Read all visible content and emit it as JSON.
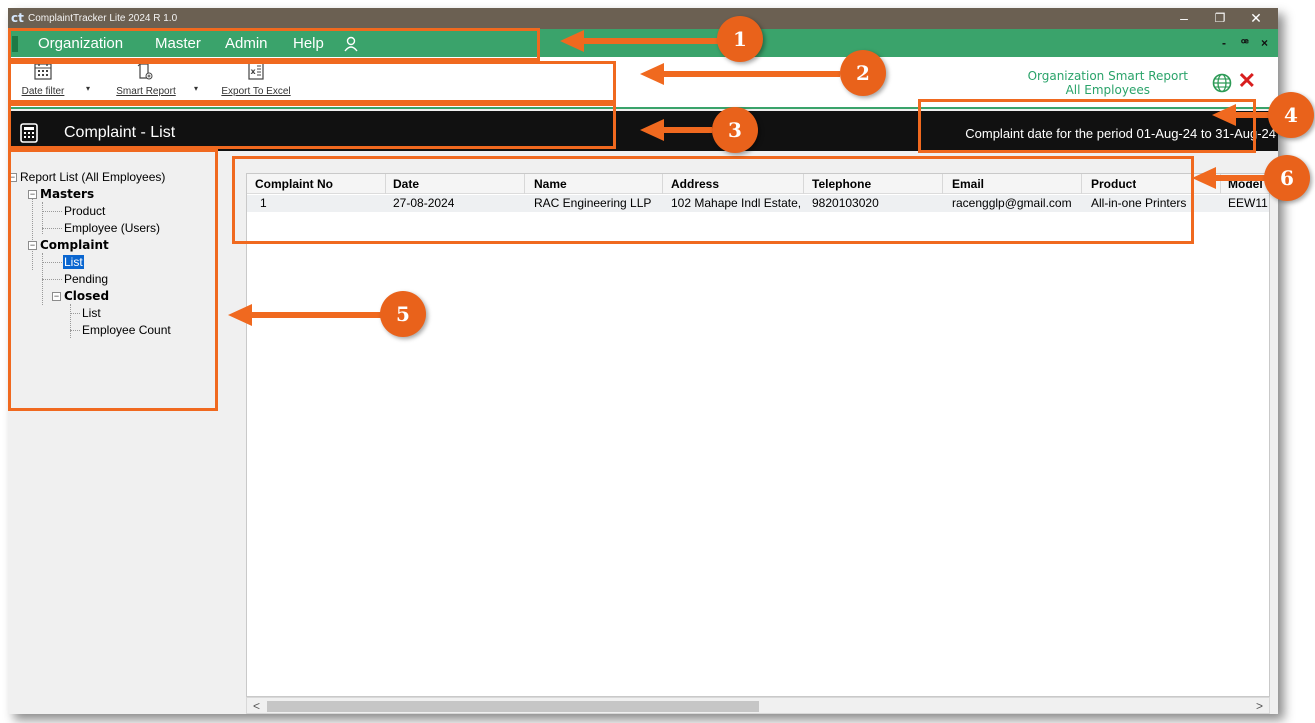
{
  "window": {
    "logo": "ct",
    "title": "ComplaintTracker Lite 2024 R 1.0",
    "controls": [
      "–",
      "❐",
      "✕"
    ]
  },
  "menubar": {
    "items": [
      "Organization",
      "Master",
      "Admin",
      "Help"
    ],
    "user_icon": "user-icon",
    "mdi_controls": [
      "-",
      "ꟹ",
      "×"
    ]
  },
  "toolbar": {
    "date_filter_label": "Date filter",
    "smart_report_label": "Smart Report",
    "export_label": "Export To Excel",
    "dropdown_glyph": "▾",
    "smart_report_title": "Organization Smart Report",
    "smart_report_scope": "All Employees",
    "close_glyph": "✕"
  },
  "header": {
    "title": "Complaint - List",
    "period": "Complaint date for the period 01-Aug-24 to 31-Aug-24"
  },
  "tree": {
    "root": "Report List (All Employees)",
    "masters": "Masters",
    "product": "Product",
    "employee": "Employee (Users)",
    "complaint": "Complaint",
    "list": "List",
    "pending": "Pending",
    "closed": "Closed",
    "closed_list": "List",
    "employee_count": "Employee Count"
  },
  "grid": {
    "columns": [
      "Complaint No",
      "Date",
      "Name",
      "Address",
      "Telephone",
      "Email",
      "Product",
      "Model"
    ],
    "rows": [
      [
        "1",
        "27-08-2024",
        "RAC Engineering LLP",
        "102 Mahape Indl Estate,",
        "9820103020",
        "racengglp@gmail.com",
        "All-in-one Printers",
        "EEW11"
      ]
    ]
  },
  "scroll": {
    "left": "<",
    "right": ">"
  },
  "annotations": [
    "1",
    "2",
    "3",
    "4",
    "5",
    "6"
  ],
  "colors": {
    "menu_green": "#3aa36b",
    "header_black": "#111111",
    "annotation_orange": "#f0691f",
    "close_red": "#d81e1e",
    "selection_blue": "#0a66d0"
  }
}
